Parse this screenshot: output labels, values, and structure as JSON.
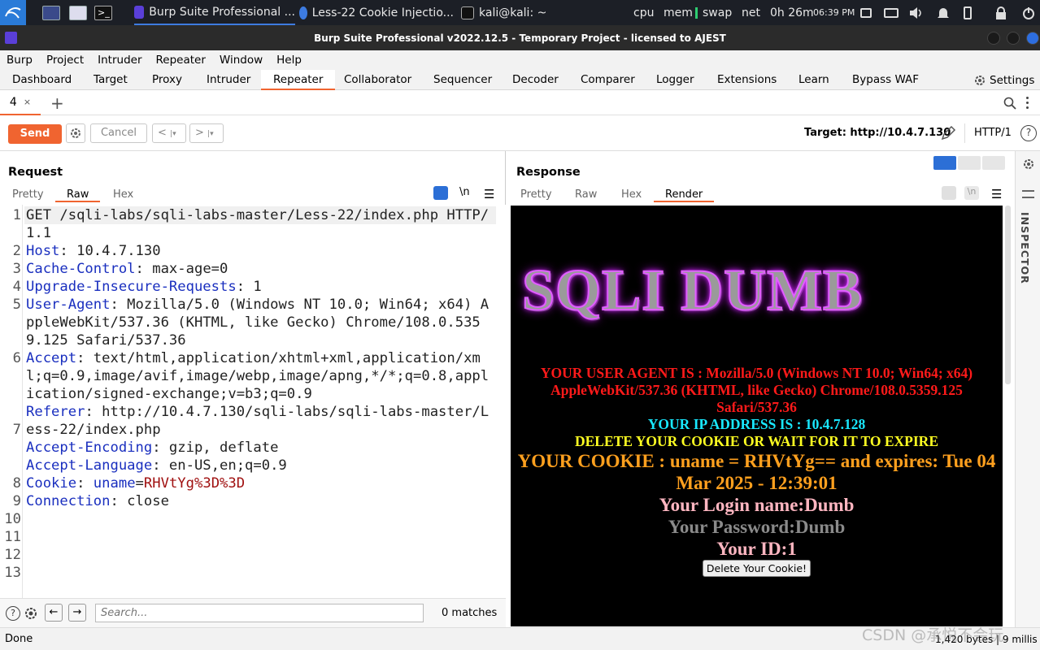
{
  "taskbar": {
    "apps": [
      {
        "label": "Burp Suite Professional ...",
        "icon": "burp-icon"
      },
      {
        "label": "Less-22 Cookie Injectio...",
        "icon": "chromium-icon"
      },
      {
        "label": "kali@kali: ~",
        "icon": "terminal-icon"
      }
    ],
    "monitors": [
      "cpu",
      "mem",
      "swap",
      "net"
    ],
    "uptime": "0h 26m",
    "clock": "06:39 PM"
  },
  "window": {
    "title": "Burp Suite Professional v2022.12.5 - Temporary Project - licensed to AJEST"
  },
  "menu": [
    "Burp",
    "Project",
    "Intruder",
    "Repeater",
    "Window",
    "Help"
  ],
  "tabs": [
    "Dashboard",
    "Target",
    "Proxy",
    "Intruder",
    "Repeater",
    "Collaborator",
    "Sequencer",
    "Decoder",
    "Comparer",
    "Logger",
    "Extensions",
    "Learn",
    "Bypass WAF"
  ],
  "settings_label": "Settings",
  "repeater_tab": {
    "label": "4",
    "close": "×",
    "add": "+"
  },
  "toolbar": {
    "send": "Send",
    "cancel": "Cancel",
    "prev": "<",
    "next": ">",
    "target": "Target: http://10.4.7.130",
    "protocol": "HTTP/1"
  },
  "request": {
    "title": "Request",
    "views": [
      "Pretty",
      "Raw",
      "Hex"
    ],
    "newline_toggle": "\\n",
    "lines": [
      {
        "n": "1",
        "parts": [
          {
            "t": "GET /sqli-labs/sqli-labs-master/Less-22/index.php HTTP/1.1",
            "c": "v"
          }
        ]
      },
      {
        "n": "2",
        "parts": [
          {
            "t": "Host",
            "c": "k"
          },
          {
            "t": ": 10.4.7.130",
            "c": "v"
          }
        ]
      },
      {
        "n": "3",
        "parts": [
          {
            "t": "Cache-Control",
            "c": "k"
          },
          {
            "t": ": max-age=0",
            "c": "v"
          }
        ]
      },
      {
        "n": "4",
        "parts": [
          {
            "t": "Upgrade-Insecure-Requests",
            "c": "k"
          },
          {
            "t": ": 1",
            "c": "v"
          }
        ]
      },
      {
        "n": "5",
        "parts": [
          {
            "t": "User-Agent",
            "c": "k"
          },
          {
            "t": ": Mozilla/5.0 (Windows NT 10.0; Win64; x64) AppleWebKit/537.36 (KHTML, like Gecko) Chrome/108.0.5359.125 Safari/537.36",
            "c": "v"
          }
        ]
      },
      {
        "n": "6",
        "parts": [
          {
            "t": "Accept",
            "c": "k"
          },
          {
            "t": ": text/html,application/xhtml+xml,application/xml;q=0.9,image/avif,image/webp,image/apng,*/*;q=0.8,application/signed-exchange;v=b3;q=0.9",
            "c": "v"
          }
        ]
      },
      {
        "n": "7",
        "parts": [
          {
            "t": "Referer",
            "c": "k"
          },
          {
            "t": ": http://10.4.7.130/sqli-labs/sqli-labs-master/Less-22/index.php",
            "c": "v"
          }
        ]
      },
      {
        "n": "8",
        "parts": [
          {
            "t": "Accept-Encoding",
            "c": "k"
          },
          {
            "t": ": gzip, deflate",
            "c": "v"
          }
        ]
      },
      {
        "n": "9",
        "parts": [
          {
            "t": "Accept-Language",
            "c": "k"
          },
          {
            "t": ": en-US,en;q=0.9",
            "c": "v"
          }
        ]
      },
      {
        "n": "10",
        "parts": [
          {
            "t": "Cookie",
            "c": "k"
          },
          {
            "t": ": ",
            "c": "v"
          },
          {
            "t": "uname",
            "c": "k"
          },
          {
            "t": "=",
            "c": "v"
          },
          {
            "t": "RHVtYg%3D%3D",
            "c": "ck"
          }
        ]
      },
      {
        "n": "11",
        "parts": [
          {
            "t": "Connection",
            "c": "k"
          },
          {
            "t": ": close",
            "c": "v"
          }
        ]
      },
      {
        "n": "12",
        "parts": []
      },
      {
        "n": "13",
        "parts": []
      }
    ],
    "search_placeholder": "Search...",
    "matches": "0 matches"
  },
  "response": {
    "title": "Response",
    "views": [
      "Pretty",
      "Raw",
      "Hex",
      "Render"
    ],
    "newline_toggle": "\\n",
    "render": {
      "banner": "SQLI DUMB",
      "user_agent": "YOUR USER AGENT IS : Mozilla/5.0 (Windows NT 10.0; Win64; x64) AppleWebKit/537.36 (KHTML, like Gecko) Chrome/108.0.5359.125 Safari/537.36",
      "ip": "YOUR IP ADDRESS IS : 10.4.7.128",
      "delete_msg": "DELETE YOUR COOKIE OR WAIT FOR IT TO EXPIRE",
      "cookie": "YOUR COOKIE : uname = RHVtYg== and expires: Tue 04 Mar 2025 - 12:39:01",
      "login": "Your Login name:Dumb",
      "password": "Your Password:Dumb",
      "id": "Your ID:1",
      "delete_button": "Delete Your Cookie!"
    },
    "colors": {
      "ua": "#ff1a1a",
      "ip": "#19e8ff",
      "delete": "#ffff22",
      "cookie": "#ffa01e",
      "login": "#ffb6c1",
      "password": "#8a8a8a",
      "id": "#ffb6c1"
    }
  },
  "inspector": "INSPECTOR",
  "status": {
    "left": "Done",
    "right": "1,420 bytes | 9 millis"
  },
  "watermark": "CSDN @承悦不会玩",
  "accent": "#f06430"
}
